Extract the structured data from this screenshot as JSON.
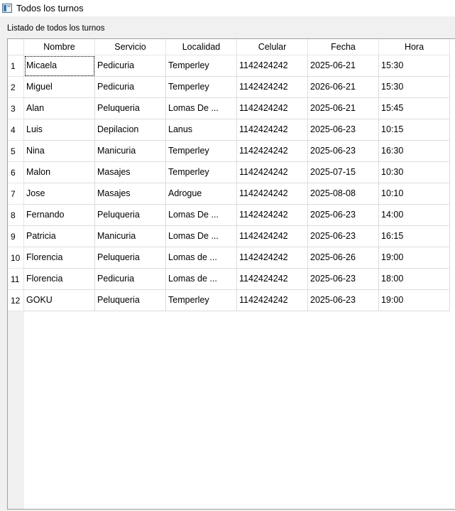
{
  "window": {
    "title": "Todos los turnos"
  },
  "group_label": "Listado de todos los turnos",
  "table": {
    "columns": [
      "Nombre",
      "Servicio",
      "Localidad",
      "Celular",
      "Fecha",
      "Hora"
    ],
    "row_numbers": [
      "1",
      "2",
      "3",
      "4",
      "5",
      "6",
      "7",
      "8",
      "9",
      "10",
      "11",
      "12"
    ],
    "rows": [
      [
        "Micaela",
        "Pedicuria",
        "Temperley",
        "1142424242",
        "2025-06-21",
        "15:30"
      ],
      [
        "Miguel",
        "Pedicuria",
        "Temperley",
        "1142424242",
        "2026-06-21",
        "15:30"
      ],
      [
        "Alan",
        "Peluqueria",
        "Lomas De ...",
        "1142424242",
        "2025-06-21",
        "15:45"
      ],
      [
        "Luis",
        "Depilacion",
        "Lanus",
        "1142424242",
        "2025-06-23",
        "10:15"
      ],
      [
        "Nina",
        "Manicuria",
        "Temperley",
        "1142424242",
        "2025-06-23",
        "16:30"
      ],
      [
        "Malon",
        "Masajes",
        "Temperley",
        "1142424242",
        "2025-07-15",
        "10:30"
      ],
      [
        "Jose",
        "Masajes",
        "Adrogue",
        "1142424242",
        "2025-08-08",
        "10:10"
      ],
      [
        "Fernando",
        "Peluqueria",
        "Lomas De ...",
        "1142424242",
        "2025-06-23",
        "14:00"
      ],
      [
        "Patricia",
        "Manicuria",
        "Lomas De ...",
        "1142424242",
        "2025-06-23",
        "16:15"
      ],
      [
        "Florencia",
        "Peluqueria",
        "Lomas de ...",
        "1142424242",
        "2025-06-26",
        "19:00"
      ],
      [
        "Florencia",
        "Pedicuria",
        "Lomas de ...",
        "1142424242",
        "2025-06-23",
        "18:00"
      ],
      [
        "GOKU",
        "Peluqueria",
        "Temperley",
        "1142424242",
        "2025-06-23",
        "19:00"
      ]
    ]
  }
}
